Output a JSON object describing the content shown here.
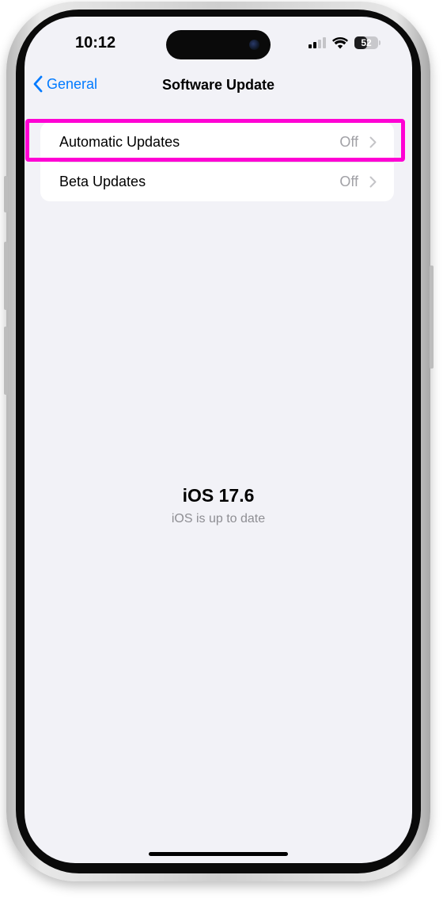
{
  "status_bar": {
    "time": "10:12",
    "battery": "52",
    "battery_level": 0.52
  },
  "nav": {
    "back_label": "General",
    "title": "Software Update"
  },
  "settings": {
    "rows": [
      {
        "label": "Automatic Updates",
        "value": "Off"
      },
      {
        "label": "Beta Updates",
        "value": "Off"
      }
    ]
  },
  "status": {
    "version": "iOS 17.6",
    "message": "iOS is up to date"
  },
  "colors": {
    "accent": "#007aff",
    "highlight": "#ff00d4",
    "background": "#f2f2f7"
  }
}
